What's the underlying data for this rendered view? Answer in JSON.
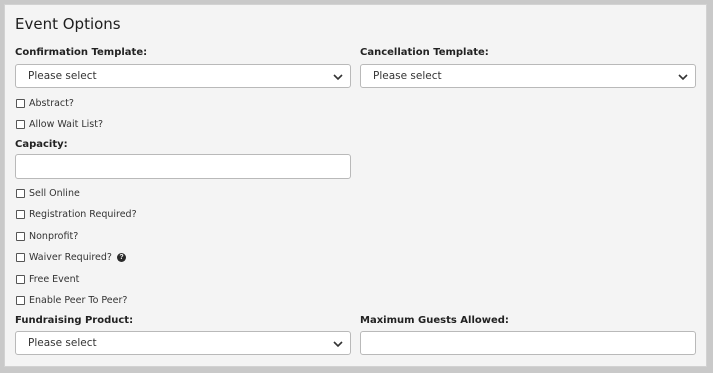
{
  "panel": {
    "title": "Event Options"
  },
  "confirmation_template": {
    "label": "Confirmation Template:",
    "value": "Please select"
  },
  "cancellation_template": {
    "label": "Cancellation Template:",
    "value": "Please select"
  },
  "checkboxes_top": [
    {
      "label": "Abstract?",
      "checked": false
    },
    {
      "label": "Allow Wait List?",
      "checked": false
    }
  ],
  "capacity": {
    "label": "Capacity:",
    "value": ""
  },
  "checkboxes_bottom": [
    {
      "label": "Sell Online",
      "checked": false
    },
    {
      "label": "Registration Required?",
      "checked": false
    },
    {
      "label": "Nonprofit?",
      "checked": false
    },
    {
      "label": "Waiver Required?",
      "checked": false,
      "help_icon": "question-circle-icon"
    },
    {
      "label": "Free Event",
      "checked": false
    },
    {
      "label": "Enable Peer To Peer?",
      "checked": false
    }
  ],
  "help_glyph": "?",
  "fundraising_product": {
    "label": "Fundraising Product:",
    "value": "Please select"
  },
  "maximum_guests": {
    "label": "Maximum Guests Allowed:",
    "value": ""
  }
}
